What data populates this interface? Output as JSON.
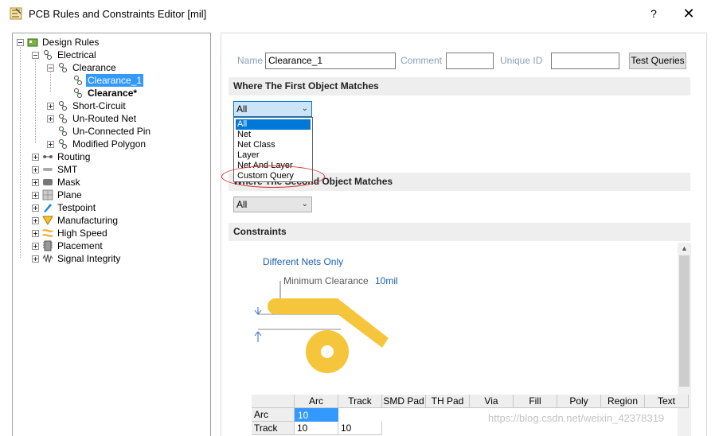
{
  "window": {
    "title": "PCB Rules and Constraints Editor [mil]",
    "help_label": "?",
    "close_label": "✕"
  },
  "tree": {
    "items": [
      {
        "label": "Design Rules",
        "icon": "design-rules-folder-icon"
      },
      {
        "label": "Electrical",
        "icon": "electrical-rule-icon"
      },
      {
        "label": "Clearance",
        "icon": "clearance-rule-icon"
      },
      {
        "label": "Clearance_1",
        "icon": "clearance-rule-icon",
        "selected": true
      },
      {
        "label": "Clearance*",
        "icon": "clearance-rule-icon",
        "bold": true
      },
      {
        "label": "Short-Circuit",
        "icon": "short-circuit-rule-icon"
      },
      {
        "label": "Un-Routed Net",
        "icon": "unrouted-net-rule-icon"
      },
      {
        "label": "Un-Connected Pin",
        "icon": "unconnected-pin-rule-icon"
      },
      {
        "label": "Modified Polygon",
        "icon": "modified-polygon-rule-icon"
      },
      {
        "label": "Routing",
        "icon": "routing-rule-icon"
      },
      {
        "label": "SMT",
        "icon": "smt-rule-icon"
      },
      {
        "label": "Mask",
        "icon": "mask-rule-icon"
      },
      {
        "label": "Plane",
        "icon": "plane-rule-icon"
      },
      {
        "label": "Testpoint",
        "icon": "testpoint-rule-icon"
      },
      {
        "label": "Manufacturing",
        "icon": "manufacturing-rule-icon"
      },
      {
        "label": "High Speed",
        "icon": "high-speed-rule-icon"
      },
      {
        "label": "Placement",
        "icon": "placement-rule-icon"
      },
      {
        "label": "Signal Integrity",
        "icon": "signal-integrity-rule-icon"
      }
    ]
  },
  "rule": {
    "name_label": "Name",
    "name_value": "Clearance_1",
    "comment_label": "Comment",
    "comment_value": "",
    "unique_id_label": "Unique ID",
    "unique_id_value": "",
    "test_queries_label": "Test Queries"
  },
  "first_object": {
    "header": "Where The First Object Matches",
    "selected": "All",
    "options": [
      "All",
      "Net",
      "Net Class",
      "Layer",
      "Net And Layer",
      "Custom Query"
    ]
  },
  "second_object": {
    "header": "Where The Second Object Matches",
    "selected": "All"
  },
  "constraints": {
    "header": "Constraints",
    "mode": "Different Nets Only",
    "min_clearance_label": "Minimum Clearance",
    "min_clearance_value": "10mil",
    "matrix": {
      "columns": [
        "Arc",
        "Track",
        "SMD Pad",
        "TH Pad",
        "Via",
        "Fill",
        "Poly",
        "Region",
        "Text"
      ],
      "rows": [
        {
          "label": "Arc",
          "values": [
            "10"
          ]
        },
        {
          "label": "Track",
          "values": [
            "10",
            "10"
          ]
        }
      ]
    }
  },
  "colors": {
    "selection": "#3399ff",
    "pad_copper": "#f5c63b",
    "highlight_ellipse": "#d9302c",
    "label_gray_blue": "#8aa1b8",
    "link_blue": "#1a5fb4"
  },
  "watermark": "https://blog.csdn.net/weixin_42378319"
}
